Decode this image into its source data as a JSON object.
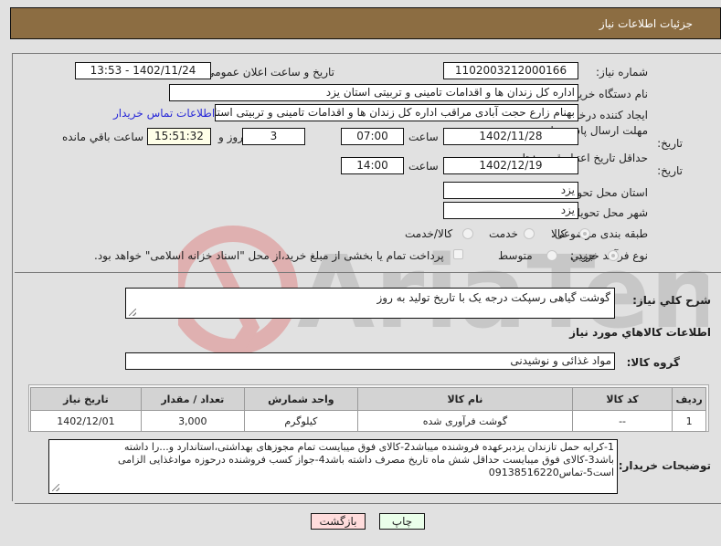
{
  "header": {
    "title": "جزئیات اطلاعات نیاز"
  },
  "fields": {
    "need_number_label": "شماره نیاز:",
    "need_number": "1102003212000166",
    "announce_label": "تاریخ و ساعت اعلان عمومی:",
    "announce_value": "1402/11/24 - 13:53",
    "buyer_org_label": "نام دستگاه خریدار:",
    "buyer_org": "اداره کل زندان ها و اقدامات تامینی و تربیتی استان یزد",
    "creator_label": "ایجاد کننده درخواست:",
    "creator": "بهنام زارع حجت آبادی مراقب اداره کل زندان ها و اقدامات تامینی و تربیتی استان",
    "buyer_contact_link": "اطلاعات تماس خریدار",
    "deadline_label_1": "مهلت ارسال پاسخ: تا",
    "deadline_label_2": "تاریخ:",
    "deadline_date": "1402/11/28",
    "time_label": "ساعت",
    "deadline_time": "07:00",
    "days_remaining": "3",
    "days_and_label": "روز و",
    "time_remaining": "15:51:32",
    "remaining_label": "ساعت باقي مانده",
    "price_validity_label_1": "حداقل تاریخ اعتبار قیمت: تا",
    "price_validity_label_2": "تاریخ:",
    "price_validity_date": "1402/12/19",
    "price_validity_time": "14:00",
    "province_label": "استان محل تحویل:",
    "province": "یزد",
    "city_label": "شهر محل تحویل:",
    "city": "یزد",
    "category_label": "طبقه بندی موضوعی:",
    "category_options": [
      "کالا",
      "خدمت",
      "کالا/خدمت"
    ],
    "category_selected": "کالا",
    "process_label": "نوع فرآیند خرید :",
    "process_options": [
      "جزیي",
      "متوسط"
    ],
    "process_selected": "جزیي",
    "treasury_text": "پرداخت تمام یا بخشی از مبلغ خرید،از محل \"اسناد خزانه اسلامی\" خواهد بود."
  },
  "description": {
    "label": "شرح کلي نياز:",
    "value": "گوشت گیاهی رسپکت درجه یک با تاریخ تولید به روز"
  },
  "goods": {
    "section_title": "اطلاعات کالاهاي مورد نياز",
    "group_label": "گروه کالا:",
    "group_value": "مواد غذائی و نوشیدنی",
    "columns": [
      "رديف",
      "کد کالا",
      "نام کالا",
      "واحد شمارش",
      "تعداد / مقدار",
      "تاريخ نياز"
    ],
    "rows": [
      {
        "index": "1",
        "code": "--",
        "name": "گوشت فرآوری شده",
        "unit": "کیلوگرم",
        "quantity": "3,000",
        "date": "1402/12/01"
      }
    ]
  },
  "buyer_notes": {
    "label": "توضیحات خریدار:",
    "lines": [
      "1-کرایه حمل تازندان یزدبرعهده فروشنده میباشد2-کالای فوق میبایست تمام مجوزهای بهداشتی،استاندارد و...را داشته",
      "باشد3-کالای فوق میبایست حداقل شش ماه تاریخ مصرف داشته باشد4-جواز کسب فروشنده درحوزه موادغذایی الزامی",
      "است5-تماس09138516220"
    ]
  },
  "buttons": {
    "print": "چاپ",
    "back": "بازگشت"
  },
  "colors": {
    "header": "#8c6d42",
    "link": "#2a2ad8",
    "print_bg": "#eaffea",
    "back_bg": "#ffdcdc"
  }
}
